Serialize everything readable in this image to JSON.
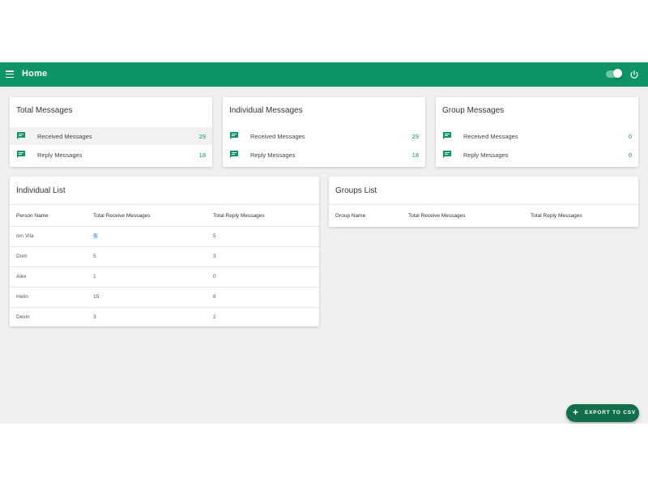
{
  "header": {
    "title": "Home"
  },
  "cards": [
    {
      "title": "Total Messages",
      "received_label": "Received Messages",
      "received_value": "29",
      "reply_label": "Reply Messages",
      "reply_value": "18"
    },
    {
      "title": "Individual Messages",
      "received_label": "Received Messages",
      "received_value": "29",
      "reply_label": "Reply Messages",
      "reply_value": "18"
    },
    {
      "title": "Group Messages",
      "received_label": "Received Messages",
      "received_value": "0",
      "reply_label": "Reply Messages",
      "reply_value": "0"
    }
  ],
  "individual_list": {
    "title": "Individual List",
    "columns": [
      "Person Name",
      "Total Receive Messages",
      "Total Reply Messages"
    ],
    "rows": [
      [
        "Ion Vila",
        "5",
        "5"
      ],
      [
        "Dom",
        "5",
        "3"
      ],
      [
        "Alex",
        "1",
        "0"
      ],
      [
        "Helin",
        "15",
        "8"
      ],
      [
        "Devin",
        "3",
        "2"
      ]
    ]
  },
  "groups_list": {
    "title": "Groups List",
    "columns": [
      "Group Name",
      "Total Receive Messages",
      "Total Reply Messages"
    ]
  },
  "fab": {
    "label": "EXPORT TO CSV"
  },
  "colors": {
    "primary": "#0e9466",
    "fab": "#106e49",
    "background": "#f0f0f0"
  },
  "icons": {
    "menu": "menu-icon",
    "power": "power-icon",
    "message": "message-icon",
    "add": "plus-icon"
  }
}
